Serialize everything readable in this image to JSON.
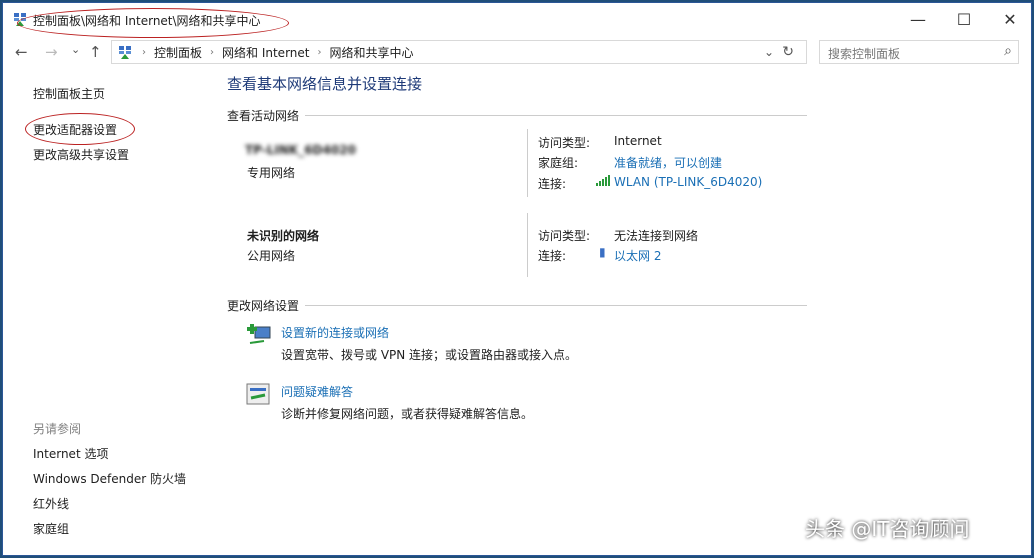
{
  "window": {
    "title": "控制面板\\网络和 Internet\\网络和共享中心",
    "minimize": "—",
    "maximize": "☐",
    "close": "✕"
  },
  "nav": {
    "back": "←",
    "forward": "→",
    "recent": "⌄",
    "up": "↑",
    "breadcrumb": [
      "控制面板",
      "网络和 Internet",
      "网络和共享中心"
    ],
    "refresh": "↻",
    "dropdown": "⌄",
    "search_placeholder": "搜索控制面板",
    "search_icon": "⌕"
  },
  "sidebar": {
    "items": [
      "控制面板主页",
      "更改适配器设置",
      "更改高级共享设置"
    ],
    "see_also_heading": "另请参阅",
    "see_also": [
      "Internet 选项",
      "Windows Defender 防火墙",
      "红外线",
      "家庭组"
    ]
  },
  "main": {
    "title": "查看基本网络信息并设置连接",
    "active_heading": "查看活动网络",
    "networks": [
      {
        "name": "TP-LINK_6D4020",
        "type": "专用网络",
        "rows": [
          {
            "label": "访问类型:",
            "value": "Internet"
          },
          {
            "label": "家庭组:",
            "value": "准备就绪，可以创建"
          },
          {
            "label": "连接:",
            "value": "WLAN (TP-LINK_6D4020)"
          }
        ]
      },
      {
        "name": "未识别的网络",
        "type": "公用网络",
        "rows": [
          {
            "label": "访问类型:",
            "value": "无法连接到网络"
          },
          {
            "label": "连接:",
            "value": "以太网 2"
          }
        ]
      }
    ],
    "change_heading": "更改网络设置",
    "tasks": [
      {
        "title": "设置新的连接或网络",
        "desc": "设置宽带、拨号或 VPN 连接；或设置路由器或接入点。"
      },
      {
        "title": "问题疑难解答",
        "desc": "诊断并修复网络问题，或者获得疑难解答信息。"
      }
    ]
  },
  "watermark": "头条 @IT咨询顾问"
}
